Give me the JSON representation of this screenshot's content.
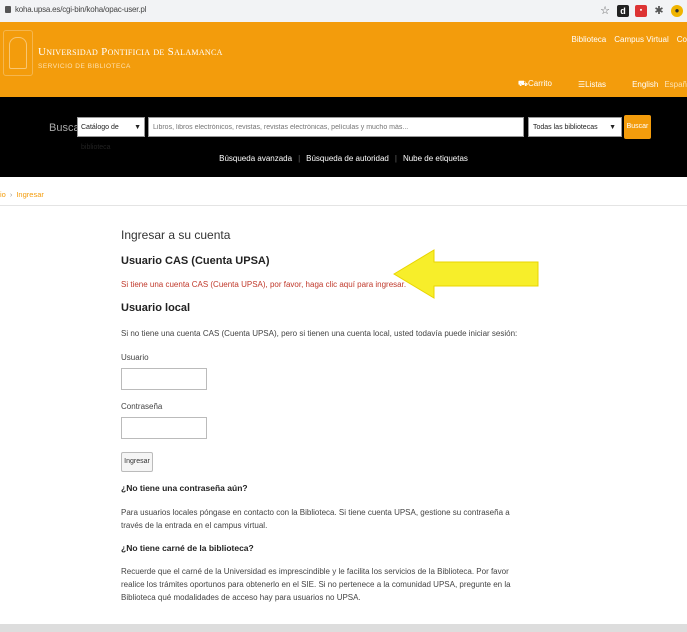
{
  "browser": {
    "url": "koha.upsa.es/cgi-bin/koha/opac-user.pl",
    "icons": [
      "star-icon",
      "bold-icon",
      "extension-icon",
      "puzzle-icon",
      "profile-icon"
    ]
  },
  "header": {
    "university_name": "Universidad Pontificia de Salamanca",
    "subtitle": "SERVICIO DE BIBLIOTECA",
    "top_links": [
      "Biblioteca",
      "Campus Virtual",
      "Co"
    ],
    "cart_label": "Carrito",
    "lists_label": "Listas",
    "languages": [
      "English",
      "Españ"
    ],
    "color": "#f39c0c"
  },
  "search": {
    "label": "Buscar",
    "catalog_select": "Catálogo de biblioteca",
    "placeholder": "Libros, libros electrónicos, revistas, revistas electrónicas, películas y mucho más...",
    "library_select": "Todas las bibliotecas",
    "button": "Buscar",
    "links": [
      "Búsqueda avanzada",
      "Búsqueda de autoridad",
      "Nube de etiquetas"
    ]
  },
  "breadcrumb": {
    "home": "io",
    "current": "Ingresar"
  },
  "login": {
    "title": "Ingresar a su cuenta",
    "cas_heading": "Usuario CAS (Cuenta UPSA)",
    "cas_link": "Si tiene una cuenta CAS (Cuenta UPSA), por favor, haga clic aquí para ingresar.",
    "local_heading": "Usuario local",
    "local_text": "Si no tiene una cuenta CAS (Cuenta UPSA), pero si tienen una cuenta local, usted todavía puede iniciar sesión:",
    "user_label": "Usuario",
    "password_label": "Contraseña",
    "submit": "Ingresar",
    "no_password_heading": "¿No tiene una contraseña aún?",
    "no_password_text": "Para usuarios locales póngase en contacto con la Biblioteca. Si tiene cuenta UPSA, gestione su contraseña a través de la entrada en el campus virtual.",
    "no_card_heading": "¿No tiene carné de la biblioteca?",
    "no_card_text": "Recuerde que el carné de la Universidad es imprescindible y le facilita los servicios de la Biblioteca. Por favor realice los trámites oportunos para obtenerlo en el SIE. Si no pertenece a la comunidad UPSA, pregunte en la Biblioteca qué modalidades de acceso hay para usuarios no UPSA."
  },
  "annotation": {
    "arrow_color": "#f7ee2a"
  }
}
